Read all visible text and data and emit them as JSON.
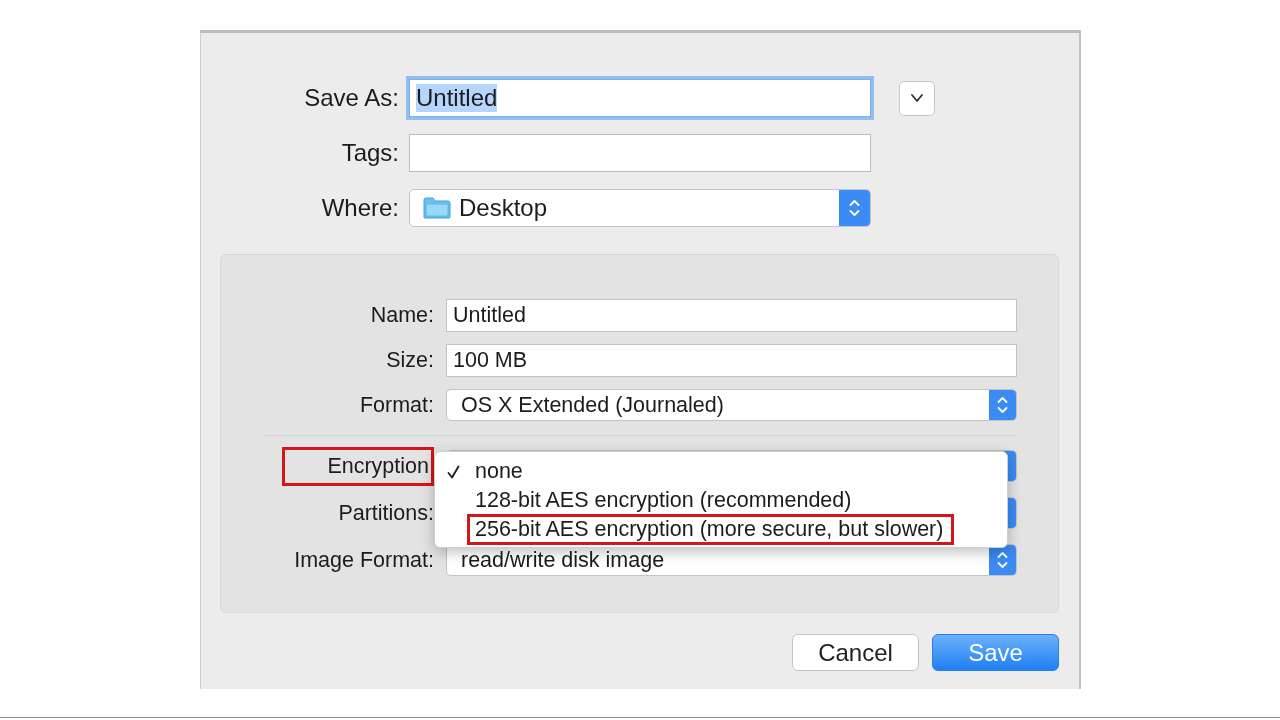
{
  "dialog": {
    "save_as": {
      "label": "Save As:",
      "value": "Untitled",
      "focused": true,
      "text_selected": true
    },
    "options_toggle": {
      "expanded": false
    },
    "tags": {
      "label": "Tags:"
    },
    "where": {
      "label": "Where:",
      "value": "Desktop"
    }
  },
  "image_options": {
    "volume_fields": [
      {
        "kind": "text",
        "label": "Name:",
        "value": "Untitled"
      },
      {
        "kind": "text",
        "label": "Size:",
        "value": "100 MB"
      },
      {
        "kind": "popup",
        "label": "Format:",
        "value": "OS X Extended (Journaled)"
      }
    ],
    "image_fields": [
      {
        "kind": "popup",
        "label": "Encryption",
        "highlighted": true
      },
      {
        "kind": "popup",
        "label": "Partitions:",
        "highlighted": false
      },
      {
        "kind": "popup",
        "label": "Image Format:",
        "value": "read/write disk image",
        "highlighted": false
      }
    ],
    "encryption_menu": {
      "items": [
        {
          "label": "none",
          "checked": true,
          "highlighted": false
        },
        {
          "label": "128-bit AES encryption (recommended)",
          "checked": false,
          "highlighted": false
        },
        {
          "label": "256-bit AES encryption (more secure, but slower)",
          "checked": false,
          "highlighted": true
        }
      ]
    }
  },
  "buttons": [
    {
      "label": "Cancel",
      "kind": "normal"
    },
    {
      "label": "Save",
      "kind": "default"
    }
  ]
}
